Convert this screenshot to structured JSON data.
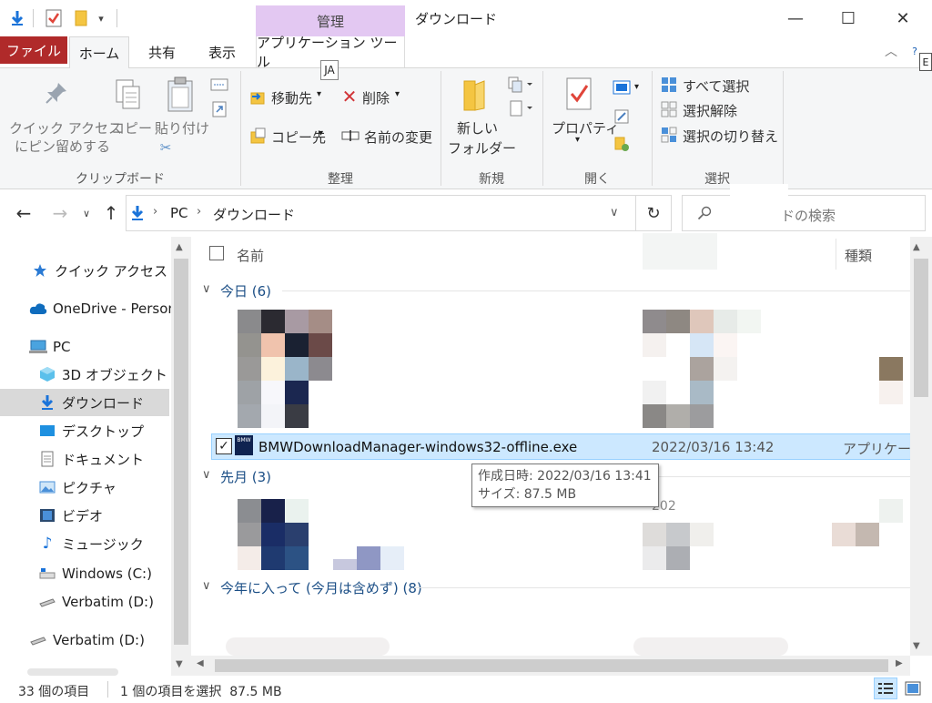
{
  "window": {
    "title": "ダウンロード",
    "manage_tab": "管理",
    "minimize": "—",
    "maximize": "☐",
    "close": "✕"
  },
  "ribbon_tabs": {
    "file": "ファイル",
    "home": "ホーム",
    "share": "共有",
    "view": "表示",
    "app_tools": "アプリケーション ツール",
    "ime": "JA",
    "edge_letter": "E"
  },
  "clipboard": {
    "pin_line1": "クイック アクセス",
    "pin_line2": "にピン留めする",
    "copy": "コピー",
    "paste": "貼り付け",
    "label": "クリップボード"
  },
  "organize": {
    "move_to": "移動先",
    "copy_to": "コピー先",
    "delete": "削除",
    "rename": "名前の変更",
    "label": "整理"
  },
  "new_group": {
    "new_folder_line1": "新しい",
    "new_folder_line2": "フォルダー",
    "label": "新規"
  },
  "open_group": {
    "properties": "プロパティ",
    "label": "開く"
  },
  "select_group": {
    "select_all": "すべて選択",
    "select_none": "選択解除",
    "invert": "選択の切り替え",
    "label": "選択"
  },
  "address": {
    "pc": "PC",
    "folder": "ダウンロード",
    "search_placeholder": "ドの検索"
  },
  "nav": {
    "items": [
      {
        "label": "クイック アクセス",
        "icon": "star-icon"
      },
      {
        "label": "OneDrive - Persona",
        "icon": "cloud-icon"
      },
      {
        "label": "PC",
        "icon": "computer-icon"
      },
      {
        "label": "3D オブジェクト",
        "icon": "cube-icon"
      },
      {
        "label": "ダウンロード",
        "icon": "download-icon"
      },
      {
        "label": "デスクトップ",
        "icon": "desktop-icon"
      },
      {
        "label": "ドキュメント",
        "icon": "document-icon"
      },
      {
        "label": "ピクチャ",
        "icon": "picture-icon"
      },
      {
        "label": "ビデオ",
        "icon": "video-icon"
      },
      {
        "label": "ミュージック",
        "icon": "music-icon"
      },
      {
        "label": "Windows (C:)",
        "icon": "drive-icon"
      },
      {
        "label": "Verbatim (D:)",
        "icon": "usb-drive-icon"
      },
      {
        "label": "Verbatim (D:)",
        "icon": "usb-drive-icon"
      }
    ]
  },
  "columns": {
    "name": "名前",
    "type": "種類"
  },
  "groups": {
    "today": "今日 (6)",
    "last_month": "先月 (3)",
    "this_year": "今年に入って (今月は含めず) (8)"
  },
  "selected_file": {
    "icon_text": "BMW",
    "name": "BMWDownloadManager-windows32-offline.exe",
    "date": "2022/03/16 13:42",
    "type": "アプリケーション"
  },
  "tooltip": {
    "created": "作成日時: 2022/03/16 13:41",
    "size": "サイズ: 87.5 MB"
  },
  "partial_text": {
    "year_fragment": "202"
  },
  "status": {
    "count": "33 個の項目",
    "selection": "1 個の項目を選択  87.5 MB"
  },
  "colors": {
    "accent_blue": "#0078d7",
    "file_tab": "#b02a2a",
    "manage_tab": "#e3c8f2",
    "selection": "#cce8ff"
  }
}
